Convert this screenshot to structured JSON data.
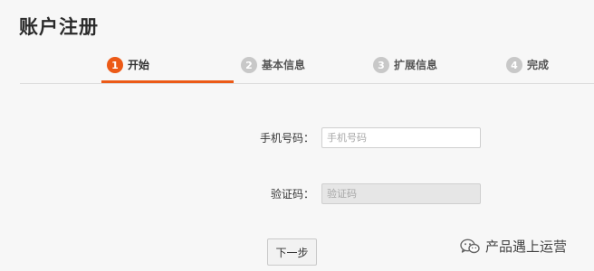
{
  "page": {
    "title": "账户注册"
  },
  "steps": [
    {
      "num": "1",
      "label": "开始",
      "active": true
    },
    {
      "num": "2",
      "label": "基本信息",
      "active": false
    },
    {
      "num": "3",
      "label": "扩展信息",
      "active": false
    },
    {
      "num": "4",
      "label": "完成",
      "active": false
    }
  ],
  "form": {
    "phone": {
      "label": "手机号码：",
      "placeholder": "手机号码",
      "value": ""
    },
    "code": {
      "label": "验证码：",
      "placeholder": "验证码",
      "value": "",
      "disabled": true
    }
  },
  "actions": {
    "next_label": "下一步"
  },
  "watermark": {
    "text": "产品遇上运营",
    "icon": "wechat-icon"
  },
  "colors": {
    "accent": "#ec5a17",
    "inactive_step": "#c8c8c8",
    "background": "#f7f7f7"
  }
}
